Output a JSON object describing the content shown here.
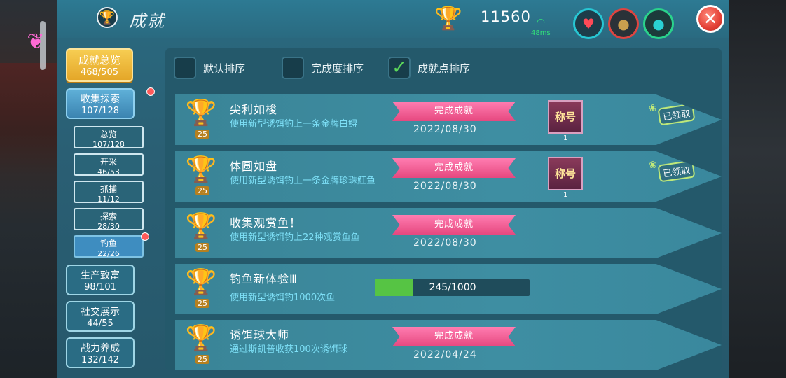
{
  "header": {
    "title": "成就",
    "score": "11560",
    "ping": "48ms"
  },
  "nav": {
    "main": {
      "label": "成就总览",
      "count": "468/505"
    },
    "categories": [
      {
        "label": "收集探索",
        "count": "107/128"
      },
      {
        "label": "生产致富",
        "count": "98/101"
      },
      {
        "label": "社交展示",
        "count": "44/55"
      },
      {
        "label": "战力养成",
        "count": "132/142"
      }
    ],
    "subs": [
      {
        "label": "总览",
        "count": "107/128"
      },
      {
        "label": "开采",
        "count": "46/53"
      },
      {
        "label": "抓捕",
        "count": "11/12"
      },
      {
        "label": "探索",
        "count": "28/30"
      },
      {
        "label": "钓鱼",
        "count": "22/26"
      }
    ]
  },
  "sort": {
    "options": [
      {
        "label": "默认排序",
        "checked": false
      },
      {
        "label": "完成度排序",
        "checked": false
      },
      {
        "label": "成就点排序",
        "checked": true
      }
    ]
  },
  "achievements": [
    {
      "title": "尖利如梭",
      "desc": "使用新型诱饵钓上一条金牌白鲟",
      "points": "25",
      "status": "完成成就",
      "date": "2022/08/30",
      "reward_label": "称号",
      "reward_count": "1",
      "claimed_label": "已领取"
    },
    {
      "title": "体圆如盘",
      "desc": "使用新型诱饵钓上一条金牌珍珠魟鱼",
      "points": "25",
      "status": "完成成就",
      "date": "2022/08/30",
      "reward_label": "称号",
      "reward_count": "1",
      "claimed_label": "已领取"
    },
    {
      "title": "收集观赏鱼！",
      "desc": "使用新型诱饵钓上22种观赏鱼鱼",
      "points": "25",
      "status": "完成成就",
      "date": "2022/08/30"
    },
    {
      "title": "钓鱼新体验Ⅲ",
      "desc": "使用新型诱饵钓1000次鱼",
      "points": "25",
      "progress_text": "245/1000",
      "progress_value": 245,
      "progress_max": 1000
    },
    {
      "title": "诱饵球大师",
      "desc": "通过斯凯普收获100次诱饵球",
      "points": "25",
      "status": "完成成就",
      "date": "2022/04/24"
    }
  ]
}
